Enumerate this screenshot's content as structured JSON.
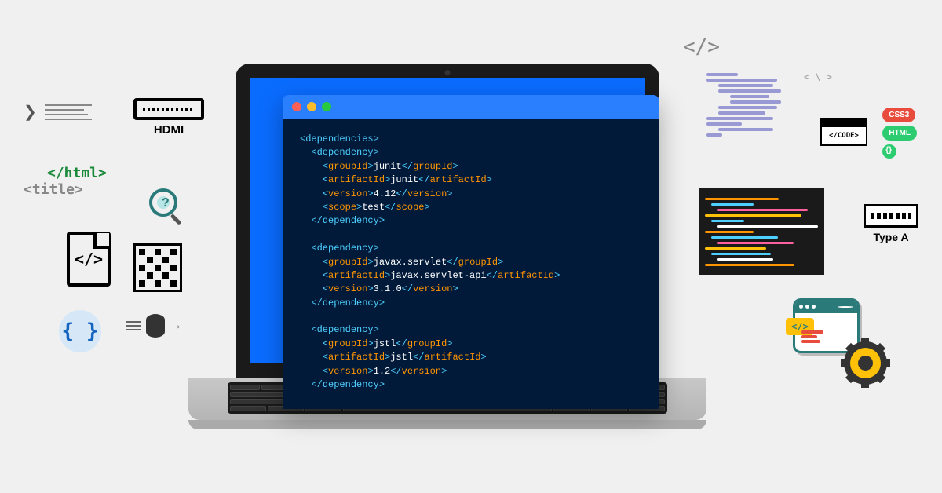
{
  "code": {
    "lines": [
      {
        "indent": 0,
        "parts": [
          {
            "t": "tag",
            "v": "<"
          },
          {
            "t": "tag",
            "v": "dependencies"
          },
          {
            "t": "tag",
            "v": ">"
          }
        ]
      },
      {
        "indent": 1,
        "parts": [
          {
            "t": "tag",
            "v": "<"
          },
          {
            "t": "tag",
            "v": "dependency"
          },
          {
            "t": "tag",
            "v": ">"
          }
        ]
      },
      {
        "indent": 2,
        "parts": [
          {
            "t": "tag",
            "v": "<"
          },
          {
            "t": "name",
            "v": "groupId"
          },
          {
            "t": "tag",
            "v": ">"
          },
          {
            "t": "val",
            "v": "junit"
          },
          {
            "t": "tag",
            "v": "</"
          },
          {
            "t": "name",
            "v": "groupId"
          },
          {
            "t": "tag",
            "v": ">"
          }
        ]
      },
      {
        "indent": 2,
        "parts": [
          {
            "t": "tag",
            "v": "<"
          },
          {
            "t": "name",
            "v": "artifactId"
          },
          {
            "t": "tag",
            "v": ">"
          },
          {
            "t": "val",
            "v": "junit"
          },
          {
            "t": "tag",
            "v": "</"
          },
          {
            "t": "name",
            "v": "artifactId"
          },
          {
            "t": "tag",
            "v": ">"
          }
        ]
      },
      {
        "indent": 2,
        "parts": [
          {
            "t": "tag",
            "v": "<"
          },
          {
            "t": "name",
            "v": "version"
          },
          {
            "t": "tag",
            "v": ">"
          },
          {
            "t": "val",
            "v": "4.12"
          },
          {
            "t": "tag",
            "v": "</"
          },
          {
            "t": "name",
            "v": "version"
          },
          {
            "t": "tag",
            "v": ">"
          }
        ]
      },
      {
        "indent": 2,
        "parts": [
          {
            "t": "tag",
            "v": "<"
          },
          {
            "t": "name",
            "v": "scope"
          },
          {
            "t": "tag",
            "v": ">"
          },
          {
            "t": "val",
            "v": "test"
          },
          {
            "t": "tag",
            "v": "</"
          },
          {
            "t": "name",
            "v": "scope"
          },
          {
            "t": "tag",
            "v": ">"
          }
        ]
      },
      {
        "indent": 1,
        "parts": [
          {
            "t": "tag",
            "v": "</"
          },
          {
            "t": "tag",
            "v": "dependency"
          },
          {
            "t": "tag",
            "v": ">"
          }
        ]
      },
      {
        "indent": 0,
        "parts": []
      },
      {
        "indent": 1,
        "parts": [
          {
            "t": "tag",
            "v": "<"
          },
          {
            "t": "tag",
            "v": "dependency"
          },
          {
            "t": "tag",
            "v": ">"
          }
        ]
      },
      {
        "indent": 2,
        "parts": [
          {
            "t": "tag",
            "v": "<"
          },
          {
            "t": "name",
            "v": "groupId"
          },
          {
            "t": "tag",
            "v": ">"
          },
          {
            "t": "val",
            "v": "javax.servlet"
          },
          {
            "t": "tag",
            "v": "</"
          },
          {
            "t": "name",
            "v": "groupId"
          },
          {
            "t": "tag",
            "v": ">"
          }
        ]
      },
      {
        "indent": 2,
        "parts": [
          {
            "t": "tag",
            "v": "<"
          },
          {
            "t": "name",
            "v": "artifactId"
          },
          {
            "t": "tag",
            "v": ">"
          },
          {
            "t": "val",
            "v": "javax.servlet-api"
          },
          {
            "t": "tag",
            "v": "</"
          },
          {
            "t": "name",
            "v": "artifactId"
          },
          {
            "t": "tag",
            "v": ">"
          }
        ]
      },
      {
        "indent": 2,
        "parts": [
          {
            "t": "tag",
            "v": "<"
          },
          {
            "t": "name",
            "v": "version"
          },
          {
            "t": "tag",
            "v": ">"
          },
          {
            "t": "val",
            "v": "3.1.0"
          },
          {
            "t": "tag",
            "v": "</"
          },
          {
            "t": "name",
            "v": "version"
          },
          {
            "t": "tag",
            "v": ">"
          }
        ]
      },
      {
        "indent": 1,
        "parts": [
          {
            "t": "tag",
            "v": "</"
          },
          {
            "t": "tag",
            "v": "dependency"
          },
          {
            "t": "tag",
            "v": ">"
          }
        ]
      },
      {
        "indent": 0,
        "parts": []
      },
      {
        "indent": 1,
        "parts": [
          {
            "t": "tag",
            "v": "<"
          },
          {
            "t": "tag",
            "v": "dependency"
          },
          {
            "t": "tag",
            "v": ">"
          }
        ]
      },
      {
        "indent": 2,
        "parts": [
          {
            "t": "tag",
            "v": "<"
          },
          {
            "t": "name",
            "v": "groupId"
          },
          {
            "t": "tag",
            "v": ">"
          },
          {
            "t": "val",
            "v": "jstl"
          },
          {
            "t": "tag",
            "v": "</"
          },
          {
            "t": "name",
            "v": "groupId"
          },
          {
            "t": "tag",
            "v": ">"
          }
        ]
      },
      {
        "indent": 2,
        "parts": [
          {
            "t": "tag",
            "v": "<"
          },
          {
            "t": "name",
            "v": "artifactId"
          },
          {
            "t": "tag",
            "v": ">"
          },
          {
            "t": "val",
            "v": "jstl"
          },
          {
            "t": "tag",
            "v": "</"
          },
          {
            "t": "name",
            "v": "artifactId"
          },
          {
            "t": "tag",
            "v": ">"
          }
        ]
      },
      {
        "indent": 2,
        "parts": [
          {
            "t": "tag",
            "v": "<"
          },
          {
            "t": "name",
            "v": "version"
          },
          {
            "t": "tag",
            "v": ">"
          },
          {
            "t": "val",
            "v": "1.2"
          },
          {
            "t": "tag",
            "v": "</"
          },
          {
            "t": "name",
            "v": "version"
          },
          {
            "t": "tag",
            "v": ">"
          }
        ]
      },
      {
        "indent": 1,
        "parts": [
          {
            "t": "tag",
            "v": "</"
          },
          {
            "t": "tag",
            "v": "dependency"
          },
          {
            "t": "tag",
            "v": ">"
          }
        ]
      }
    ]
  },
  "left": {
    "hdmi_label": "HDMI",
    "html_close": "</html>",
    "title_tag": "<title>",
    "code_file_symbol": "</>",
    "braces": "{ }",
    "mag_q": "?"
  },
  "right": {
    "angle": "</>",
    "pseudo_tag": "< \\ >",
    "code_label": "</CODE>",
    "css3": "CSS3",
    "html": "HTML",
    "js": "{}",
    "typea_label": "Type A",
    "dev_code": "</>"
  },
  "editor_colors": [
    "#ff9500",
    "#4dd0ff",
    "#ff5f9e",
    "#ffc107",
    "#4dd0ff",
    "#fff",
    "#ff9500",
    "#4dd0ff",
    "#ff5f9e",
    "#ffc107",
    "#4dd0ff",
    "#fff",
    "#ff9500"
  ]
}
